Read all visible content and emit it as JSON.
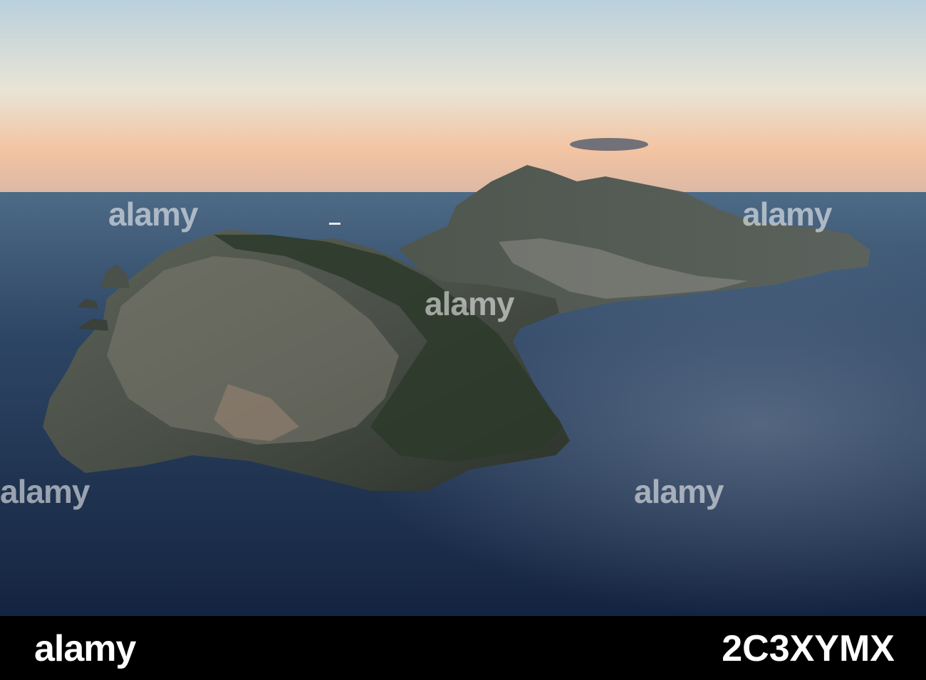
{
  "watermark": {
    "brand": "alamy"
  },
  "footer": {
    "logo": "alamy",
    "image_id": "2C3XYMX"
  },
  "colors": {
    "sky_top": "#b8d0dc",
    "sky_horizon": "#f1b892",
    "sea": "#1b2e4a",
    "cliff_dark": "#3a4336",
    "background": "#000000"
  }
}
